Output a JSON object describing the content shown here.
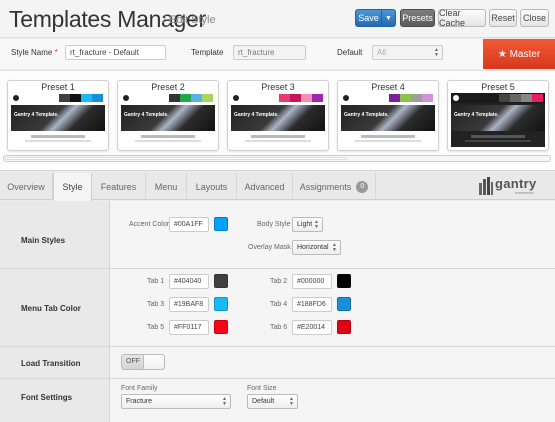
{
  "header": {
    "title": "Templates Manager",
    "subtitle": "/ Edit Style",
    "buttons": {
      "save": "Save",
      "presets": "Presets",
      "clear_cache": "Clear Cache",
      "reset": "Reset",
      "close": "Close"
    }
  },
  "style_row": {
    "name_label": "Style Name",
    "required_mark": "*",
    "name_value": "rt_fracture - Default",
    "template_label": "Template",
    "template_value": "rt_fracture",
    "default_label": "Default",
    "default_value": "All",
    "master_label": "★ Master"
  },
  "presets": [
    {
      "label": "Preset 1"
    },
    {
      "label": "Preset 2"
    },
    {
      "label": "Preset 3"
    },
    {
      "label": "Preset 4"
    },
    {
      "label": "Preset 5"
    }
  ],
  "preset_preview_text": "Gantry 4 Template.",
  "tabs": [
    {
      "label": "Overview"
    },
    {
      "label": "Style"
    },
    {
      "label": "Features"
    },
    {
      "label": "Menu"
    },
    {
      "label": "Layouts"
    },
    {
      "label": "Advanced"
    },
    {
      "label": "Assignments",
      "badge": "0"
    }
  ],
  "brand": {
    "name": "gantry",
    "tag": "framework"
  },
  "main_styles": {
    "title": "Main Styles",
    "accent_label": "Accent Color",
    "accent_value": "#00A1FF",
    "accent_color": "#00A1FF",
    "body_style_label": "Body Style",
    "body_style_value": "Light",
    "overlay_mask_label": "Overlay Mask",
    "overlay_mask_value": "Horizontal"
  },
  "menu_tab_color": {
    "title": "Menu Tab Color",
    "tabs": [
      {
        "label": "Tab 1",
        "value": "#404040",
        "color": "#404040"
      },
      {
        "label": "Tab 2",
        "value": "#000000",
        "color": "#000000"
      },
      {
        "label": "Tab 3",
        "value": "#19BAF8",
        "color": "#19BAF8"
      },
      {
        "label": "Tab 4",
        "value": "#188FD6",
        "color": "#188FD6"
      },
      {
        "label": "Tab 5",
        "value": "#FF0117",
        "color": "#FF0117"
      },
      {
        "label": "Tab 6",
        "value": "#E20014",
        "color": "#E20014"
      }
    ]
  },
  "load_transition": {
    "title": "Load Transition",
    "state": "OFF"
  },
  "font_settings": {
    "title": "Font Settings",
    "family_label": "Font Family",
    "family_value": "Fracture",
    "size_label": "Font Size",
    "size_value": "Default"
  }
}
